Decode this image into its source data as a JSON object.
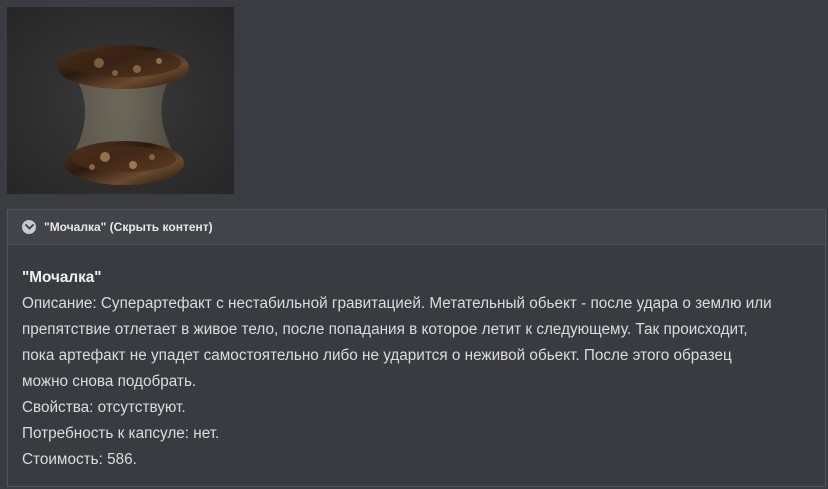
{
  "spoiler": {
    "header_label": "\"Мочалка\" (Скрыть контент)",
    "toggle_icon": "chevron-down-circle-icon"
  },
  "content": {
    "name": "\"Мочалка\"",
    "description_lines": [
      "Описание: Суперартефакт с нестабильной гравитацией. Метательный обьект - после удара о землю или",
      "препятствие отлетает в живое тело, после попадания в которое летит к следующему. Так происходит,",
      "пока артефакт не упадет самостоятельно либо не ударится о неживой обьект. После этого образец",
      "можно снова подобрать."
    ],
    "properties": "Свойства: отсутствуют.",
    "capsule": "Потребность к капсуле: нет.",
    "cost": "Стоимость: 586."
  },
  "colors": {
    "page_background": "#3b3c42",
    "header_background": "#43444a",
    "text": "#dcdcde"
  }
}
